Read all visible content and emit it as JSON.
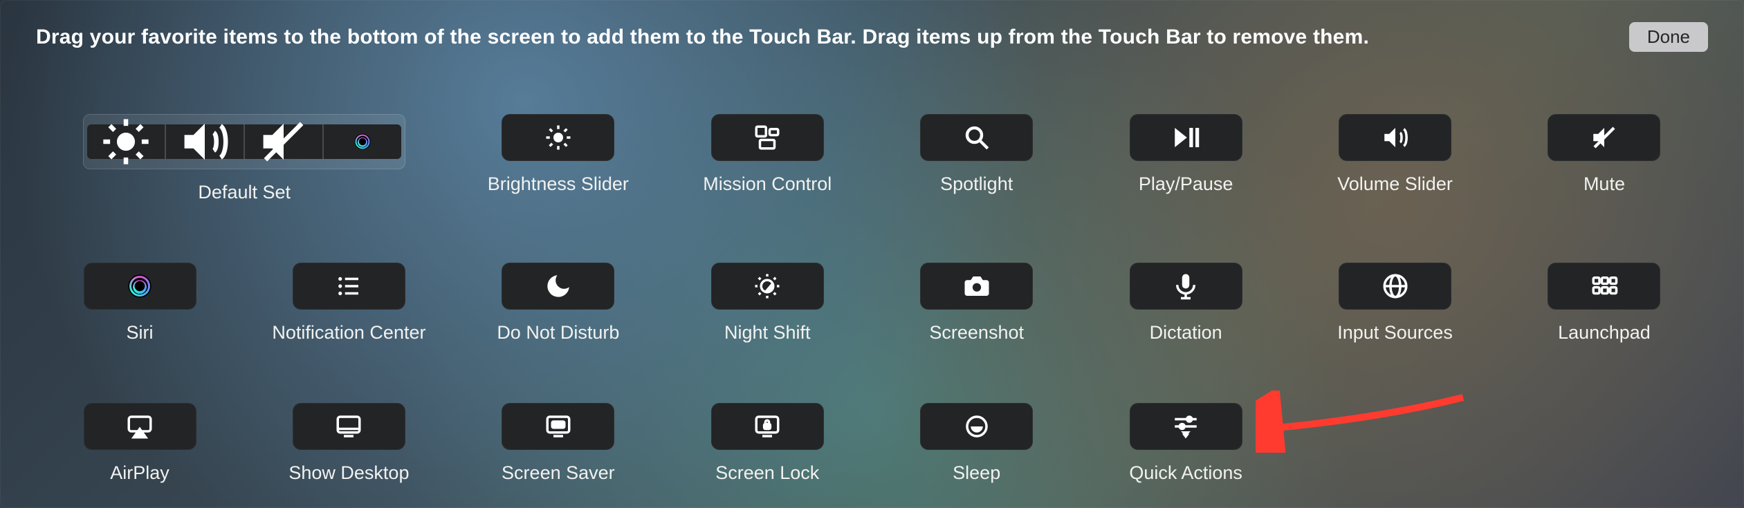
{
  "header": {
    "instruction": "Drag your favorite items to the bottom of the screen to add them to the Touch Bar. Drag items up from the Touch Bar to remove them.",
    "done": "Done"
  },
  "items": {
    "default_set": "Default Set",
    "brightness_slider": "Brightness Slider",
    "mission_control": "Mission Control",
    "spotlight": "Spotlight",
    "play_pause": "Play/Pause",
    "volume_slider": "Volume Slider",
    "mute": "Mute",
    "siri": "Siri",
    "notification_center": "Notification Center",
    "do_not_disturb": "Do Not Disturb",
    "night_shift": "Night Shift",
    "screenshot": "Screenshot",
    "dictation": "Dictation",
    "input_sources": "Input Sources",
    "launchpad": "Launchpad",
    "airplay": "AirPlay",
    "show_desktop": "Show Desktop",
    "screen_saver": "Screen Saver",
    "screen_lock": "Screen Lock",
    "sleep": "Sleep",
    "quick_actions": "Quick Actions"
  }
}
